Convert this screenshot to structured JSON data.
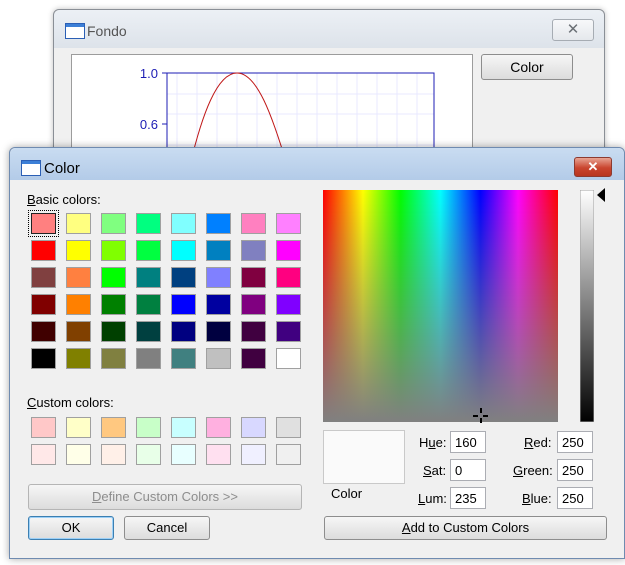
{
  "background_window": {
    "title": "Fondo",
    "close_glyph": "✕",
    "color_button": "Color",
    "plot": {
      "y_ticks": [
        "1.0",
        "0.6"
      ]
    }
  },
  "dialog": {
    "title": "Color",
    "close_glyph": "✕",
    "basic_label_u": "B",
    "basic_label_rest": "asic colors:",
    "custom_label_u": "C",
    "custom_label_rest": "ustom colors:",
    "basic_colors": [
      "#ff8080",
      "#ffff80",
      "#80ff80",
      "#00ff80",
      "#80ffff",
      "#0080ff",
      "#ff80c0",
      "#ff80ff",
      "#ff0000",
      "#ffff00",
      "#80ff00",
      "#00ff40",
      "#00ffff",
      "#0080c0",
      "#8080c0",
      "#ff00ff",
      "#804040",
      "#ff8040",
      "#00ff00",
      "#008080",
      "#004080",
      "#8080ff",
      "#800040",
      "#ff0080",
      "#800000",
      "#ff8000",
      "#008000",
      "#008040",
      "#0000ff",
      "#0000a0",
      "#800080",
      "#8000ff",
      "#400000",
      "#804000",
      "#004000",
      "#004040",
      "#000080",
      "#000040",
      "#400040",
      "#400080",
      "#000000",
      "#808000",
      "#808040",
      "#808080",
      "#408080",
      "#c0c0c0",
      "#400040",
      "#ffffff"
    ],
    "custom_colors": [
      "#ffc8c8",
      "#ffffc8",
      "#ffc880",
      "#c8ffc8",
      "#c8ffff",
      "#ffb0e0",
      "#d8d8ff",
      "#e0e0e0",
      "#ffe8e8",
      "#ffffe8",
      "#fff0e8",
      "#e8ffe8",
      "#e8ffff",
      "#ffe0f0",
      "#f0f0ff",
      "#f0f0f0"
    ],
    "define_custom_u": "D",
    "define_custom_rest": "efine Custom Colors >>",
    "ok_label": "OK",
    "cancel_label": "Cancel",
    "preview_label": "Color",
    "hue_u": "u",
    "hue_pre": "H",
    "hue_post": "e:",
    "hue": "160",
    "sat_u": "S",
    "sat_post": "at:",
    "sat": "0",
    "lum_u": "L",
    "lum_post": "um:",
    "lum": "235",
    "red_u": "R",
    "red_post": "ed:",
    "red": "250",
    "green_u": "G",
    "green_post": "reen:",
    "green": "250",
    "blue_u": "B",
    "blue_post": "lue:",
    "blue": "250",
    "add_custom_u": "A",
    "add_custom_rest": "dd to Custom Colors"
  }
}
